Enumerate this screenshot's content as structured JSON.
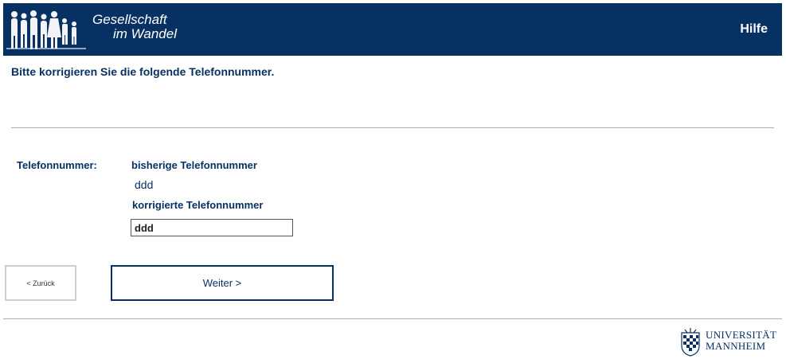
{
  "header": {
    "logo_line1": "Gesellschaft",
    "logo_line2": "im Wandel",
    "help_label": "Hilfe",
    "logo_icon": "people-silhouettes-icon"
  },
  "main": {
    "prompt": "Bitte korrigieren Sie die folgende Telefonnummer.",
    "field_label": "Telefonnummer:",
    "old_label": "bisherige Telefonnummer",
    "old_value": "ddd",
    "new_label": "korrigierte Telefonnummer",
    "new_value": "ddd"
  },
  "nav": {
    "back_label": "< Zurück",
    "next_label": "Weiter >"
  },
  "footer": {
    "university_line1": "UNIVERSITÄT",
    "university_line2": "MANNHEIM",
    "seal_icon": "university-seal-icon"
  },
  "colors": {
    "brand_navy": "#083163",
    "divider": "#b0b0b0",
    "background": "#ffffff"
  }
}
